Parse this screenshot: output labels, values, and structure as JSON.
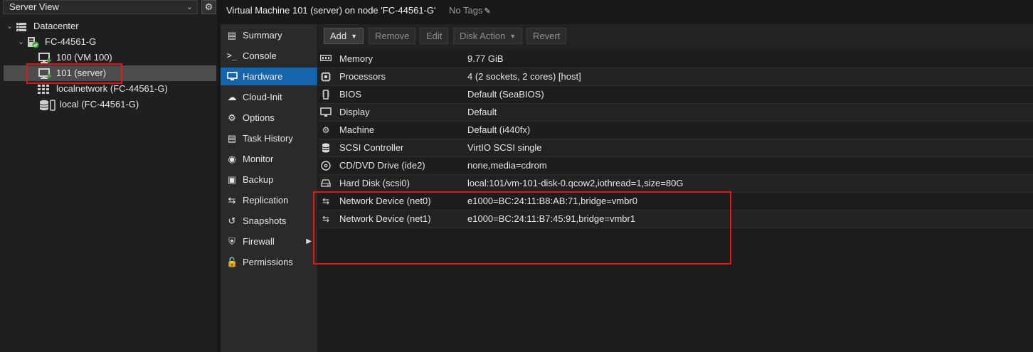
{
  "tree": {
    "view_label": "Server View",
    "items": [
      {
        "label": "Datacenter",
        "icon": "datacenter-icon"
      },
      {
        "label": "FC-44561-G",
        "icon": "node-icon"
      },
      {
        "label": "100 (VM 100)",
        "icon": "vm-icon"
      },
      {
        "label": "101 (server)",
        "icon": "vm-icon"
      },
      {
        "label": "localnetwork (FC-44561-G)",
        "icon": "network-icon"
      },
      {
        "label": "local (FC-44561-G)",
        "icon": "storage-icon"
      }
    ]
  },
  "header": {
    "title": "Virtual Machine 101 (server) on node 'FC-44561-G'",
    "tags_label": "No Tags"
  },
  "nav": {
    "items": [
      {
        "label": "Summary",
        "icon": "book-icon"
      },
      {
        "label": "Console",
        "icon": "terminal-icon"
      },
      {
        "label": "Hardware",
        "icon": "monitor-icon"
      },
      {
        "label": "Cloud-Init",
        "icon": "cloud-icon"
      },
      {
        "label": "Options",
        "icon": "gear-icon"
      },
      {
        "label": "Task History",
        "icon": "list-icon"
      },
      {
        "label": "Monitor",
        "icon": "eye-icon"
      },
      {
        "label": "Backup",
        "icon": "floppy-icon"
      },
      {
        "label": "Replication",
        "icon": "retweet-icon"
      },
      {
        "label": "Snapshots",
        "icon": "history-icon"
      },
      {
        "label": "Firewall",
        "icon": "shield-icon"
      },
      {
        "label": "Permissions",
        "icon": "unlock-icon"
      }
    ],
    "active": "Hardware"
  },
  "toolbar": {
    "add_label": "Add",
    "remove_label": "Remove",
    "edit_label": "Edit",
    "disk_action_label": "Disk Action",
    "revert_label": "Revert"
  },
  "hardware": {
    "rows": [
      {
        "name": "Memory",
        "value": "9.77 GiB",
        "icon": "memory-icon"
      },
      {
        "name": "Processors",
        "value": "4 (2 sockets, 2 cores) [host]",
        "icon": "cpu-icon"
      },
      {
        "name": "BIOS",
        "value": "Default (SeaBIOS)",
        "icon": "chip-icon"
      },
      {
        "name": "Display",
        "value": "Default",
        "icon": "display-icon"
      },
      {
        "name": "Machine",
        "value": "Default (i440fx)",
        "icon": "cogs-icon"
      },
      {
        "name": "SCSI Controller",
        "value": "VirtIO SCSI single",
        "icon": "database-icon"
      },
      {
        "name": "CD/DVD Drive (ide2)",
        "value": "none,media=cdrom",
        "icon": "disc-icon"
      },
      {
        "name": "Hard Disk (scsi0)",
        "value": "local:101/vm-101-disk-0.qcow2,iothread=1,size=80G",
        "icon": "hdd-icon"
      },
      {
        "name": "Network Device (net0)",
        "value": "e1000=BC:24:11:B8:AB:71,bridge=vmbr0",
        "icon": "exchange-icon"
      },
      {
        "name": "Network Device (net1)",
        "value": "e1000=BC:24:11:B7:45:91,bridge=vmbr1",
        "icon": "exchange-icon"
      }
    ]
  },
  "colors": {
    "accent": "#1565ad",
    "highlight": "#e0171b",
    "status_ok": "#3fa535"
  }
}
